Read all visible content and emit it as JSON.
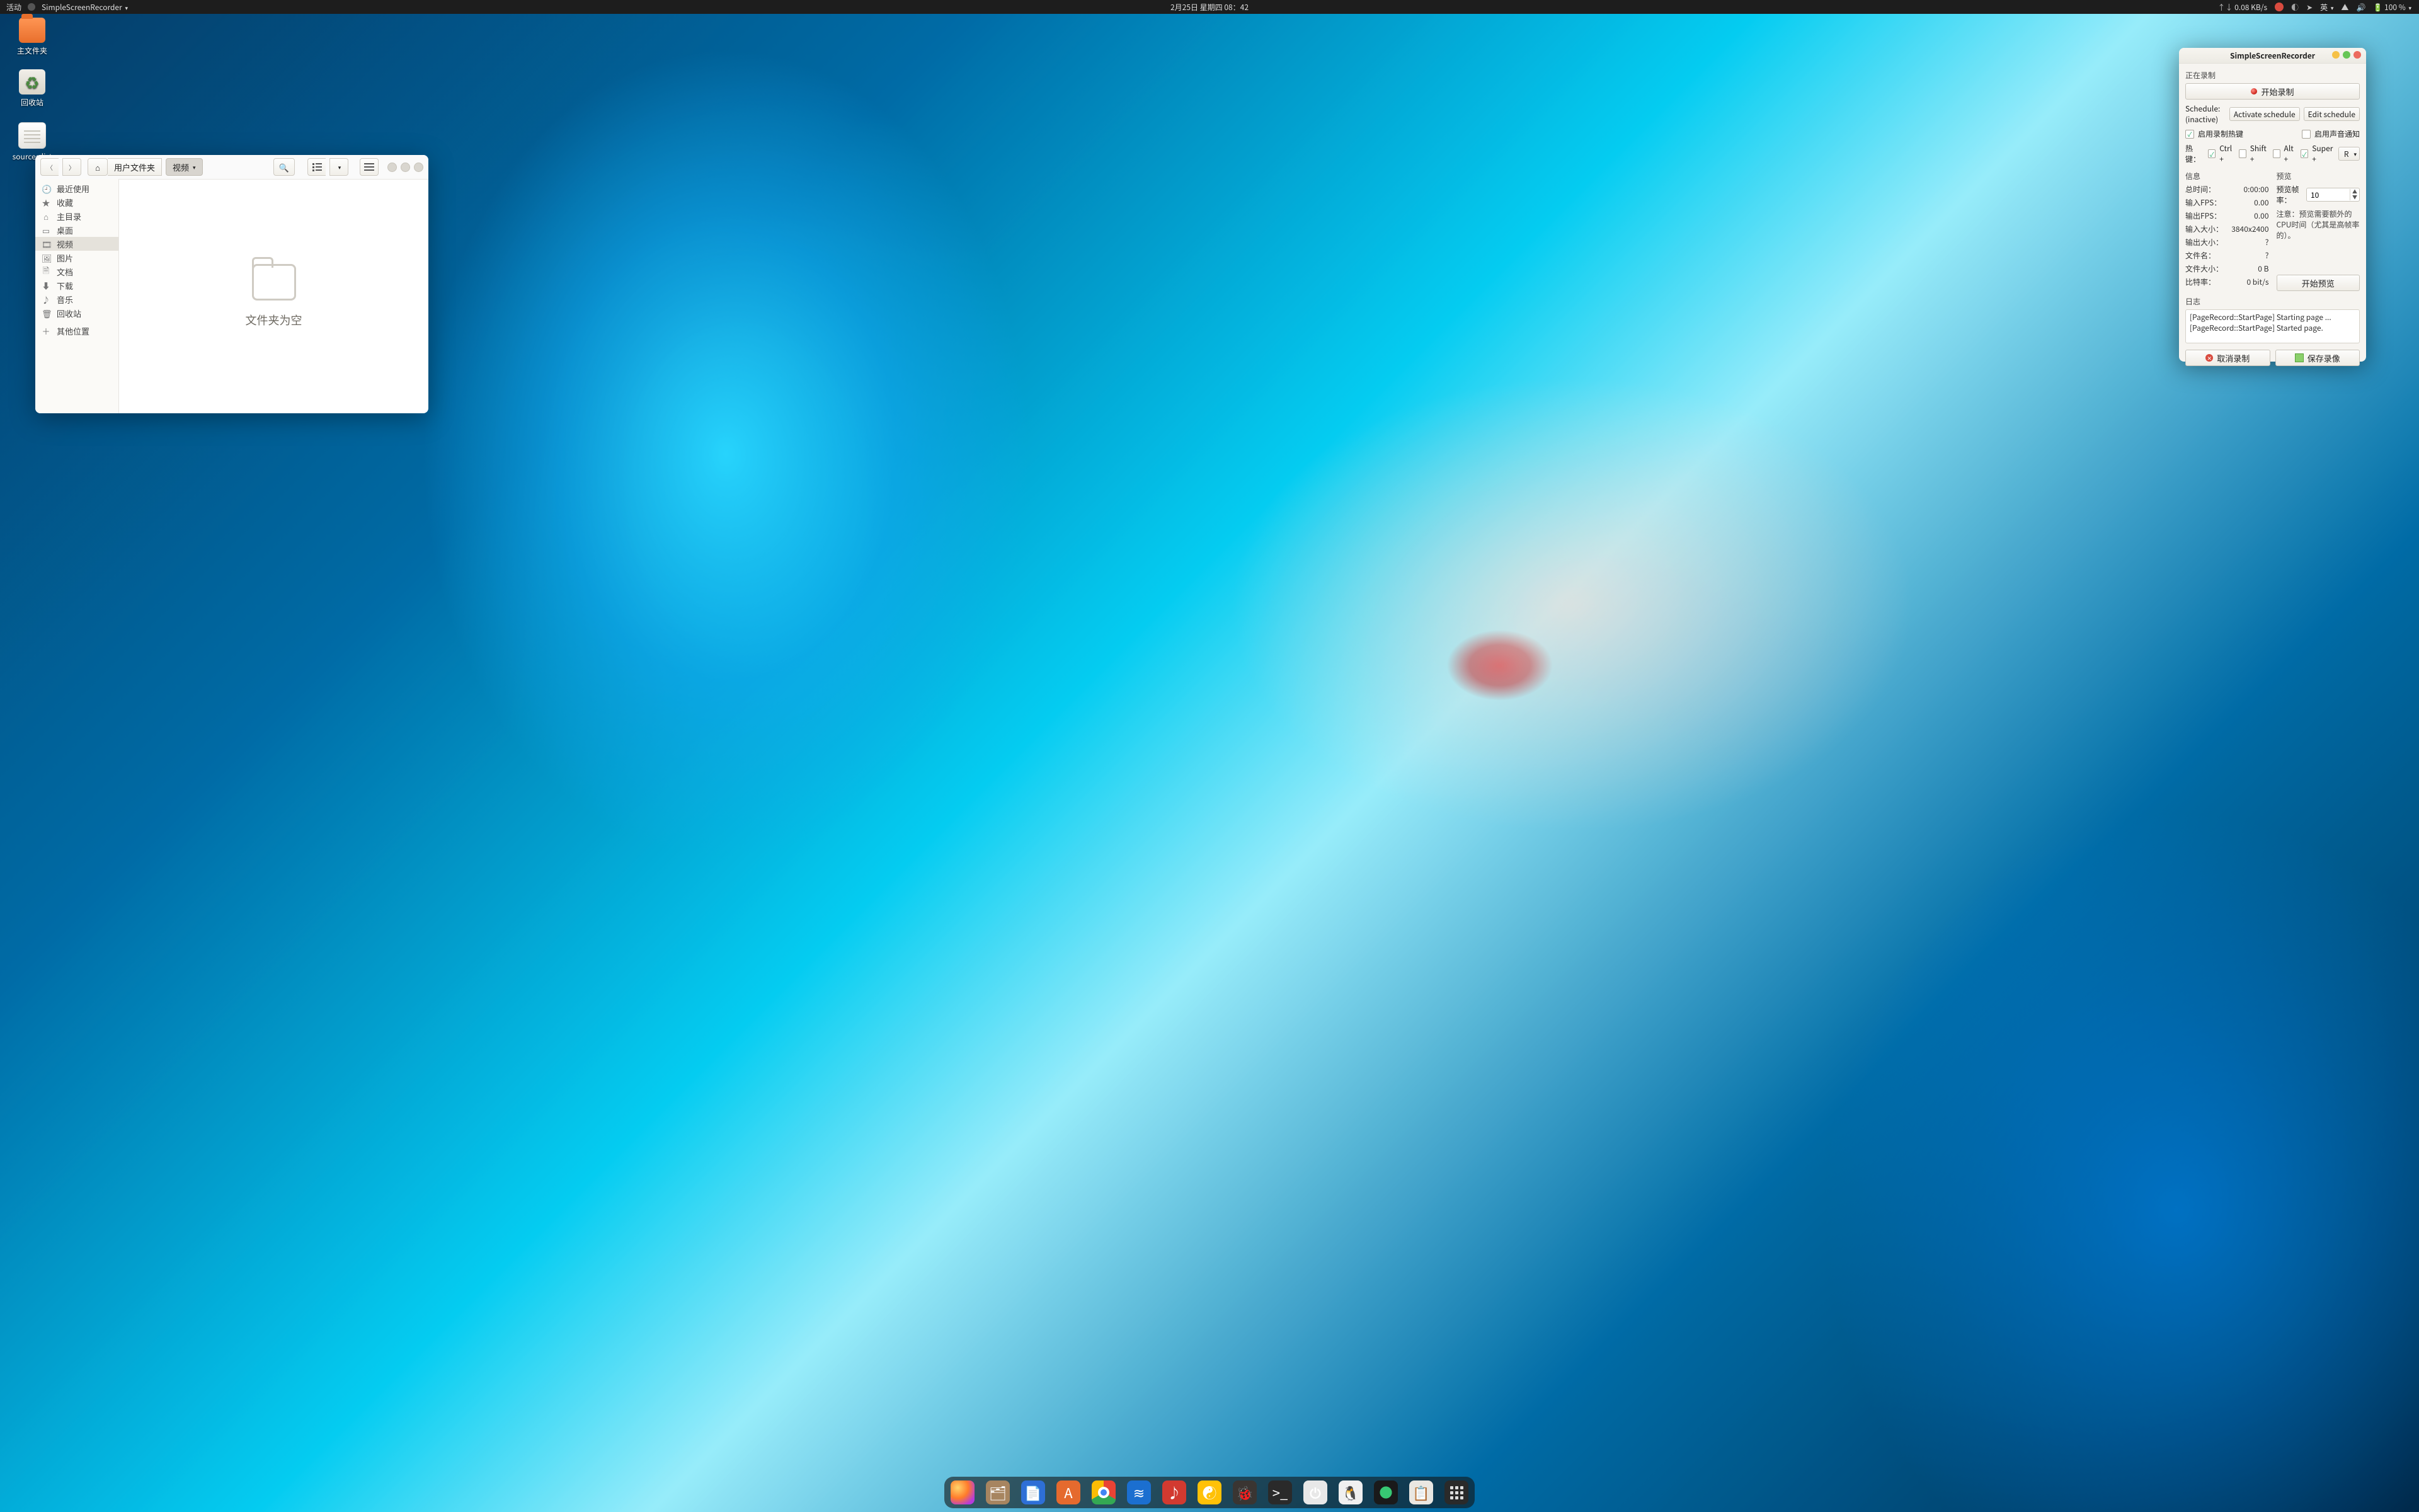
{
  "topbar": {
    "activities": "活动",
    "app_menu": "SimpleScreenRecorder",
    "datetime": "2月25日 星期四 08：42",
    "net_speed": "0.08 KB/s",
    "ime": "英",
    "battery": "100 %"
  },
  "desktop": {
    "home_folder": "主文件夹",
    "trash": "回收站",
    "sources": "sources.list"
  },
  "filemanager": {
    "path_home": "用户文件夹",
    "path_current": "视频",
    "sidebar": {
      "recent": "最近使用",
      "starred": "收藏",
      "home": "主目录",
      "desktop": "桌面",
      "videos": "视频",
      "pictures": "图片",
      "documents": "文档",
      "downloads": "下载",
      "music": "音乐",
      "trash": "回收站",
      "other": "其他位置"
    },
    "empty": "文件夹为空"
  },
  "recorder": {
    "window_title": "SimpleScreenRecorder",
    "section_recording": "正在录制",
    "start_recording": "开始录制",
    "schedule_label": "Schedule: (inactive)",
    "activate_schedule": "Activate schedule",
    "edit_schedule": "Edit schedule",
    "enable_hotkey": "启用录制热键",
    "enable_sound_notify": "启用声音通知",
    "hotkey_label": "热键：",
    "mod_ctrl": "Ctrl +",
    "mod_shift": "Shift +",
    "mod_alt": "Alt +",
    "mod_super": "Super +",
    "hotkey_key": "R",
    "section_info": "信息",
    "section_preview": "预览",
    "info": {
      "total_time_k": "总时间：",
      "total_time_v": "0:00:00",
      "fps_in_k": "输入FPS：",
      "fps_in_v": "0.00",
      "fps_out_k": "输出FPS：",
      "fps_out_v": "0.00",
      "size_in_k": "输入大小：",
      "size_in_v": "3840x2400",
      "size_out_k": "输出大小：",
      "size_out_v": "?",
      "filename_k": "文件名：",
      "filename_v": "?",
      "filesize_k": "文件大小：",
      "filesize_v": "0 B",
      "bitrate_k": "比特率：",
      "bitrate_v": "0 bit/s"
    },
    "preview_rate_label": "预览帧率：",
    "preview_rate_value": "10",
    "preview_note": "注意：预览需要额外的CPU时间（尤其是高帧率的）。",
    "start_preview": "开始预览",
    "section_log": "日志",
    "log_line1": "[PageRecord::StartPage] Starting page ...",
    "log_line2": "[PageRecord::StartPage] Started page.",
    "cancel_recording": "取消录制",
    "save_recording": "保存录像"
  }
}
